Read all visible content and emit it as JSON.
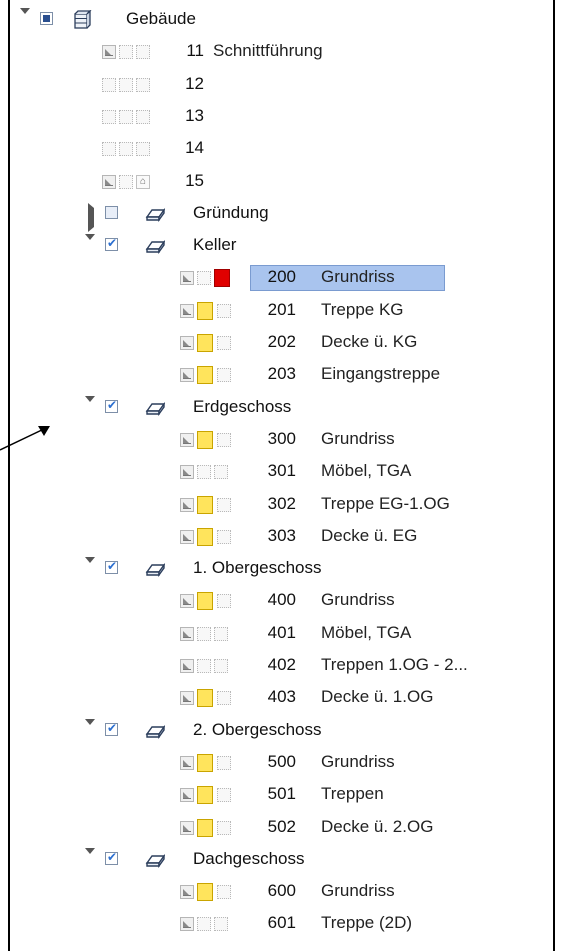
{
  "tree": {
    "root": {
      "label": "Gebäude",
      "icon": "building-icon",
      "state": "partial",
      "expanded": true
    },
    "root_children": [
      {
        "num": "11",
        "name": "Schnittführung",
        "icons": [
          "set",
          "dot",
          "dot"
        ]
      },
      {
        "num": "12",
        "name": "",
        "icons": [
          "dot",
          "dot",
          "dot"
        ]
      },
      {
        "num": "13",
        "name": "",
        "icons": [
          "dot",
          "dot",
          "dot"
        ]
      },
      {
        "num": "14",
        "name": "",
        "icons": [
          "dot",
          "dot",
          "dot"
        ]
      },
      {
        "num": "15",
        "name": "",
        "icons": [
          "set",
          "dot",
          "home"
        ]
      }
    ],
    "floors": [
      {
        "label": "Gründung",
        "checked": false,
        "expanded": false,
        "items": []
      },
      {
        "label": "Keller",
        "checked": true,
        "expanded": true,
        "items": [
          {
            "num": "200",
            "name": "Grundriss",
            "icons": [
              "set",
              "dot",
              "red"
            ],
            "selected": true
          },
          {
            "num": "201",
            "name": "Treppe KG",
            "icons": [
              "set",
              "yellow",
              "dot"
            ]
          },
          {
            "num": "202",
            "name": "Decke ü. KG",
            "icons": [
              "set",
              "yellow",
              "dot"
            ]
          },
          {
            "num": "203",
            "name": "Eingangstreppe",
            "icons": [
              "set",
              "yellow",
              "dot"
            ]
          }
        ]
      },
      {
        "label": "Erdgeschoss",
        "checked": true,
        "expanded": true,
        "items": [
          {
            "num": "300",
            "name": "Grundriss",
            "icons": [
              "set",
              "yellow",
              "dot"
            ]
          },
          {
            "num": "301",
            "name": "Möbel, TGA",
            "icons": [
              "set",
              "dot",
              "dot"
            ]
          },
          {
            "num": "302",
            "name": "Treppe EG-1.OG",
            "icons": [
              "set",
              "yellow",
              "dot"
            ]
          },
          {
            "num": "303",
            "name": "Decke ü. EG",
            "icons": [
              "set",
              "yellow",
              "dot"
            ]
          }
        ]
      },
      {
        "label": "1. Obergeschoss",
        "checked": true,
        "expanded": true,
        "items": [
          {
            "num": "400",
            "name": "Grundriss",
            "icons": [
              "set",
              "yellow",
              "dot"
            ]
          },
          {
            "num": "401",
            "name": "Möbel, TGA",
            "icons": [
              "set",
              "dot",
              "dot"
            ]
          },
          {
            "num": "402",
            "name": "Treppen 1.OG - 2...",
            "icons": [
              "set",
              "dot",
              "dot"
            ]
          },
          {
            "num": "403",
            "name": "Decke ü. 1.OG",
            "icons": [
              "set",
              "yellow",
              "dot"
            ]
          }
        ]
      },
      {
        "label": "2. Obergeschoss",
        "checked": true,
        "expanded": true,
        "items": [
          {
            "num": "500",
            "name": "Grundriss",
            "icons": [
              "set",
              "yellow",
              "dot"
            ]
          },
          {
            "num": "501",
            "name": "Treppen",
            "icons": [
              "set",
              "yellow",
              "dot"
            ]
          },
          {
            "num": "502",
            "name": "Decke ü. 2.OG",
            "icons": [
              "set",
              "yellow",
              "dot"
            ]
          }
        ]
      },
      {
        "label": "Dachgeschoss",
        "checked": true,
        "expanded": true,
        "items": [
          {
            "num": "600",
            "name": "Grundriss",
            "icons": [
              "set",
              "yellow",
              "dot"
            ]
          },
          {
            "num": "601",
            "name": "Treppe (2D)",
            "icons": [
              "set",
              "dot",
              "dot"
            ]
          }
        ]
      }
    ]
  },
  "colors": {
    "selection": "#a9c4ee",
    "active_layer": "#e00000",
    "visible_layer": "#ffe45c"
  }
}
